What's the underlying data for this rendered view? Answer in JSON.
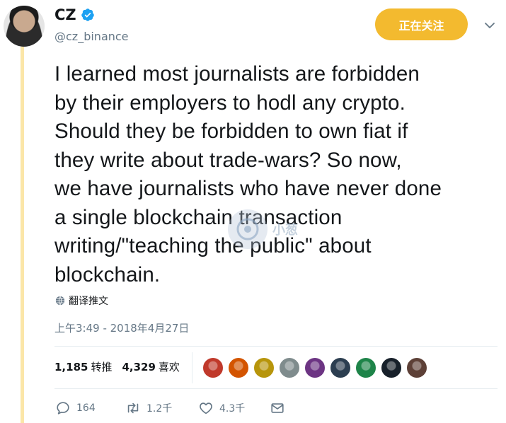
{
  "tweet": {
    "author": {
      "name": "CZ",
      "handle": "@cz_binance",
      "verified": true
    },
    "follow_label": "正在关注",
    "text": "I learned most journalists are forbidden\nby their employers to hodl any crypto.\nShould they be forbidden to own fiat if\nthey write about trade-wars?  So now,\nwe have journalists who have never done\na single blockchain transaction\nwriting/\"teaching the public\" about\nblockchain.",
    "translate_label": "翻译推文",
    "timestamp": "上午3:49 - 2018年4月27日",
    "stats": {
      "retweets_count": "1,185",
      "retweets_label": "转推",
      "likes_count": "4,329",
      "likes_label": "喜欢"
    },
    "likers": [
      {
        "name": "liker-1",
        "color": "#c0392b"
      },
      {
        "name": "liker-2",
        "color": "#d35400"
      },
      {
        "name": "liker-3",
        "color": "#b7950b"
      },
      {
        "name": "liker-4",
        "color": "#7f8c8d"
      },
      {
        "name": "liker-5",
        "color": "#6c3483"
      },
      {
        "name": "liker-6",
        "color": "#2c3e50"
      },
      {
        "name": "liker-7",
        "color": "#1e8449"
      },
      {
        "name": "liker-8",
        "color": "#17202a"
      },
      {
        "name": "liker-9",
        "color": "#5d4037"
      }
    ],
    "actions": {
      "reply_count": "164",
      "retweet_count": "1.2千",
      "like_count": "4.3千"
    }
  },
  "watermark": {
    "text": "小葱"
  },
  "colors": {
    "accent": "#f3ba2f",
    "verified": "#1da1f2",
    "muted": "#657786",
    "thread": "#fbe6a8"
  }
}
